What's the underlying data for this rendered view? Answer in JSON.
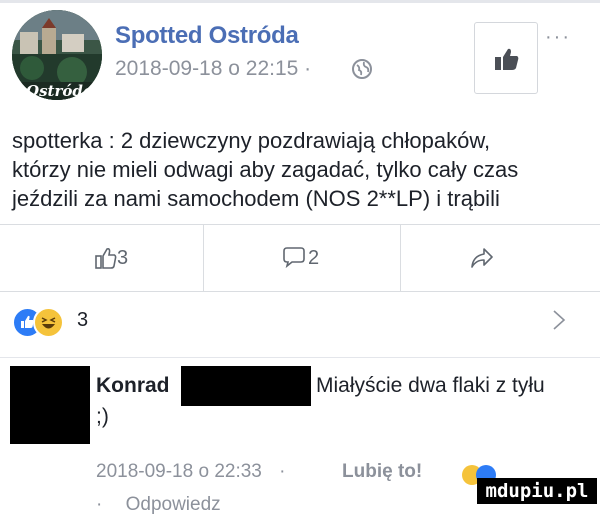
{
  "post": {
    "page_name": "Spotted Ostróda",
    "timestamp": "2018-09-18 o 22:15",
    "separator": "·",
    "avatar_script": "Ostróda",
    "more_label": "···",
    "text_lines": [
      "spotterka : 2 dziewczyny pozdrawiają chłopaków,",
      "którzy nie mieli odwagi aby zagadać, tylko cały czas",
      "jeździli za nami samochodem (NOS 2**LP) i trąbili"
    ]
  },
  "actions": {
    "like_count": "3",
    "comment_count": "2"
  },
  "reactions": {
    "count": "3"
  },
  "comment": {
    "author": "Konrad",
    "text": "Miałyście dwa flaki z tyłu",
    "text_cont": ";)",
    "timestamp": "2018-09-18 o 22:33",
    "separator": "·",
    "like_label": "Lubię to!",
    "reply_label": "Odpowiedz"
  },
  "watermark": "mdupiu.pl",
  "colors": {
    "brand": "#4b6eb5",
    "meta": "#8c919b",
    "like_blue": "#2d7cf6",
    "haha_yellow": "#f5c33b"
  },
  "icons": {
    "globe": "globe-icon",
    "like_page": "thumbs-up-icon",
    "like": "thumbs-up-outline-icon",
    "comment": "comment-bubble-icon",
    "share": "share-arrow-icon",
    "chevron": "chevron-right-icon"
  }
}
